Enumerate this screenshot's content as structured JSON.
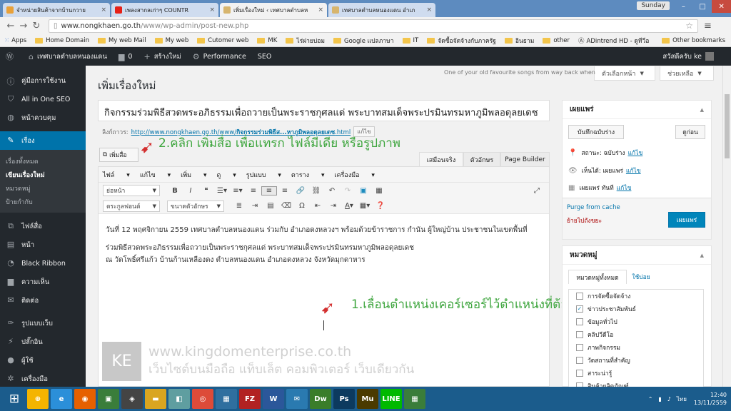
{
  "browser": {
    "tabs": [
      {
        "label": "จำหน่ายสินค้าจากบ้านกวาย",
        "fav": "#e8a13a"
      },
      {
        "label": "เพลงสากลเก่าๆ COUNTR",
        "fav": "#e62117"
      },
      {
        "label": "เพิ่มเรื่องใหม่ ‹ เทศบาลตำบลห",
        "fav": "#d7b56d"
      },
      {
        "label": "เทศบาลตำบลหนองแดน อำเภ",
        "fav": "#d7b56d"
      }
    ],
    "user_label": "Sunday",
    "url_domain": "www.nongkhaen.go.th",
    "url_path": "/www/wp-admin/post-new.php",
    "bookmarks": [
      "Apps",
      "Home Domain",
      "My web Mail",
      "My web",
      "Cutomer web",
      "MK",
      "ไร่ฝายบ่อม",
      "Google แปลภาษา",
      "IT",
      "จัดซื้อจัดจ้างกับภาครัฐ",
      "อินธาม",
      "other",
      "ADintrend HD - ดูทีวีอ"
    ],
    "other_bookmarks": "Other bookmarks"
  },
  "wp_admin_bar": {
    "site_name": "เทศบาลตำบลหนองแดน",
    "comments_count": "0",
    "new_label": "สร้างใหม่",
    "performance": "Performance",
    "seo": "SEO",
    "greeting": "สวัสดีครับ ke"
  },
  "sidebar": {
    "items": [
      {
        "label": "คู่มือการใช้งาน",
        "icon": "ⓘ"
      },
      {
        "label": "All in One SEO",
        "icon": "⛉"
      },
      {
        "label": "หน้าควบคุม",
        "icon": "◍"
      },
      {
        "label": "เรื่อง",
        "icon": "✎"
      },
      {
        "label": "ไฟล์สื่อ",
        "icon": "⧉"
      },
      {
        "label": "หน้า",
        "icon": "▤"
      },
      {
        "label": "Black Ribbon",
        "icon": "◔"
      },
      {
        "label": "ความเห็น",
        "icon": "▆"
      },
      {
        "label": "ติดต่อ",
        "icon": "✉"
      },
      {
        "label": "รูปแบบเว็บ",
        "icon": "✑"
      },
      {
        "label": "ปลั๊กอิน",
        "icon": "⚡"
      },
      {
        "label": "ผู้ใช้",
        "icon": "●"
      },
      {
        "label": "เครื่องมือ",
        "icon": "✲"
      }
    ],
    "submenu": [
      "เรื่องทั้งหมด",
      "เขียนเรื่องใหม่",
      "หมวดหมู่",
      "ป้ายกำกับ"
    ]
  },
  "screen_options": "ตัวเลือกหน้า",
  "help": "ช่วยเหลือ",
  "quote": "One of your old favourite songs from way back when",
  "page_title": "เพิ่มเรื่องใหม่",
  "post_title": "กิจกรรมร่วมพิธีสวดพระอภิธรรมเพื่อถวายเป็นพระราชกุศลแด่ พระบาทสมเด็จพระปรมินทรมหาภูมิพลอดุลยเดช",
  "permalink": {
    "label": "ลิงก์ถาวร:",
    "base": "http://www.nongkhaen.go.th/www/",
    "slug": "กิจกรรมร่วมพิธีส...หาภูมิพลอดุลยเดช",
    "suffix": ".html",
    "edit": "แก้ไข"
  },
  "annotations": {
    "step2": "2.คลิก เพิ่มสื่อ เพื่อแทรก ไฟล์มีเดีย หรือรูปภาพ",
    "step1": "1.เลื่อนตำแหน่งเคอร์เซอร์ไว้ตำแหน่งที่ต้องการแทรกรูป"
  },
  "editor": {
    "add_media": "เพิ่มสื่อ",
    "tabs": [
      "เสมือนจริง",
      "ตัวอักษร",
      "Page Builder"
    ],
    "menu": [
      "ไฟล์",
      "แก้ไข",
      "เพิ่ม",
      "ดู",
      "รูปแบบ",
      "ตาราง",
      "เครื่องมือ"
    ],
    "format_select": "ย่อหน้า",
    "font_select": "ตระกูลฟอนต์",
    "size_select": "ขนาดตัวอักษร",
    "paragraph1": "วันที่ 12 พฤศจิกายน 2559 เทศบาลตำบลหนองแดน ร่วมกับ อำเภอดงหลวงฯ พร้อมด้วยข้าราชการ กำนัน ผู้ใหญ่บ้าน ประชาชนในเขตพื้นที่",
    "paragraph2_line1": "ร่วมพิธีสวดพระอภิธรรมเพื่อถวายเป็นพระราชกุศลแด่ พระบาทสมเด็จพระปรมินทรมหาภูมิพลอดุลยเดช",
    "paragraph2_line2": "ณ วัดโพธิ์ศรีแก้ว บ้านก้านเหลืองดง ตำบลหนองแดน อำเภอดงหลวง จังหวัดมุกดาหาร"
  },
  "watermark": {
    "logo": "KE",
    "line1": "www.kingdomenterprise.co.th",
    "line2": "เว็บไซต์บนมือถือ แท็บเล็ต คอมพิวเตอร์ เว็บเดียวกัน"
  },
  "publish_box": {
    "title": "เผยแพร่",
    "save_draft": "บันทึกฉบับร่าง",
    "preview": "ดูก่อน",
    "status": "สถานะ: ฉบับร่าง",
    "visibility": "เห็นได้: เผยแพร่",
    "schedule": "เผยแพร่ ทันที",
    "edit": "แก้ไข",
    "purge": "Purge from cache",
    "trash": "ย้ายไปถังขยะ",
    "publish": "เผยแพร่"
  },
  "category_box": {
    "title": "หมวดหมู่",
    "tab_all": "หมวดหมู่ทั้งหมด",
    "tab_used": "ใช้บ่อย",
    "items": [
      {
        "label": "การจัดซื้อจัดจ้าง",
        "checked": false
      },
      {
        "label": "ข่าวประชาสัมพันธ์",
        "checked": true
      },
      {
        "label": "ข้อมูลทั่วไป",
        "checked": false
      },
      {
        "label": "คลิปวีดีโอ",
        "checked": false
      },
      {
        "label": "ภาพกิจกรรม",
        "checked": false
      },
      {
        "label": "วัดสถานที่สำคัญ",
        "checked": false
      },
      {
        "label": "สาระน่ารู้",
        "checked": false
      },
      {
        "label": "สินค้าผลิตภัณฑ์",
        "checked": false
      }
    ]
  },
  "taskbar": {
    "apps": [
      {
        "label": "⊕",
        "color": "#f4b400"
      },
      {
        "label": "e",
        "color": "#2b8fd9"
      },
      {
        "label": "◉",
        "color": "#e66000"
      },
      {
        "label": "▣",
        "color": "#3a7d3a"
      },
      {
        "label": "◈",
        "color": "#444444"
      },
      {
        "label": "▬",
        "color": "#d9a520"
      },
      {
        "label": "◧",
        "color": "#5f9ea0"
      },
      {
        "label": "◎",
        "color": "#dd4b39"
      },
      {
        "label": "▦",
        "color": "#2f6f9f"
      },
      {
        "label": "FZ",
        "color": "#b22222"
      },
      {
        "label": "W",
        "color": "#2b579a"
      },
      {
        "label": "✉",
        "color": "#2a7ab0"
      },
      {
        "label": "Dw",
        "color": "#3a7d2a"
      },
      {
        "label": "Ps",
        "color": "#0c3a5f"
      },
      {
        "label": "Mu",
        "color": "#4a3a00"
      },
      {
        "label": "LINE",
        "color": "#00b900"
      },
      {
        "label": "▦",
        "color": "#3a7d3a"
      }
    ],
    "lang": "ไทย",
    "time": "12:40",
    "date": "13/11/2559"
  }
}
